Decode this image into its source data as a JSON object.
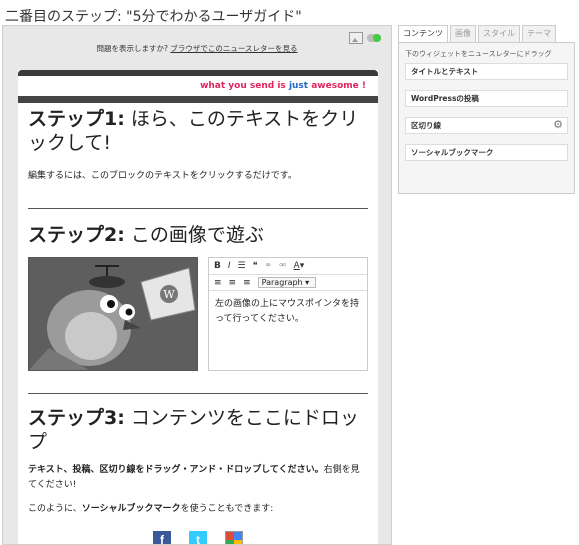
{
  "page": {
    "title": "二番目のステップ: \"5分でわかるユーザガイド\""
  },
  "frame": {
    "view_prompt": "問題を表示しますか?",
    "view_link": "ブラウザでこのニュースレターを見る"
  },
  "newsletter": {
    "tagline_prefix": "what you send is",
    "tagline_mid": "just",
    "tagline_suffix": "awesome !",
    "step1": {
      "label": "ステップ1:",
      "heading": "ほら、このテキストをクリックして!",
      "body": "編集するには、このブロックのテキストをクリックするだけです。"
    },
    "step2": {
      "label": "ステップ2:",
      "heading": "この画像で遊ぶ",
      "paragraph_select": "Paragraph",
      "editor_text": "左の画像の上にマウスポインタを持って行ってください。"
    },
    "step3": {
      "label": "ステップ3:",
      "heading": "コンテンツをここにドロップ",
      "body_bold": "テキスト、投稿、区切り線をドラッグ・アンド・ドロップしてください。",
      "body_rest": "右側を見てください!",
      "body2_prefix": "このように、",
      "body2_bold": "ソーシャルブックマーク",
      "body2_suffix": "を使うこともできます:"
    }
  },
  "sidebar": {
    "tabs": [
      "コンテンツ",
      "画像",
      "スタイル",
      "テーマ"
    ],
    "active_tab": "コンテンツ",
    "hint": "下のウィジェットをニュースレターにドラッグ",
    "widgets": [
      "タイトルとテキスト",
      "WordPressの投稿",
      "区切り線",
      "ソーシャルブックマーク"
    ]
  },
  "colors": {
    "accent_pink": "#e0245e",
    "accent_blue": "#2266cc",
    "facebook": "#3b5998",
    "twitter": "#33ccff"
  }
}
